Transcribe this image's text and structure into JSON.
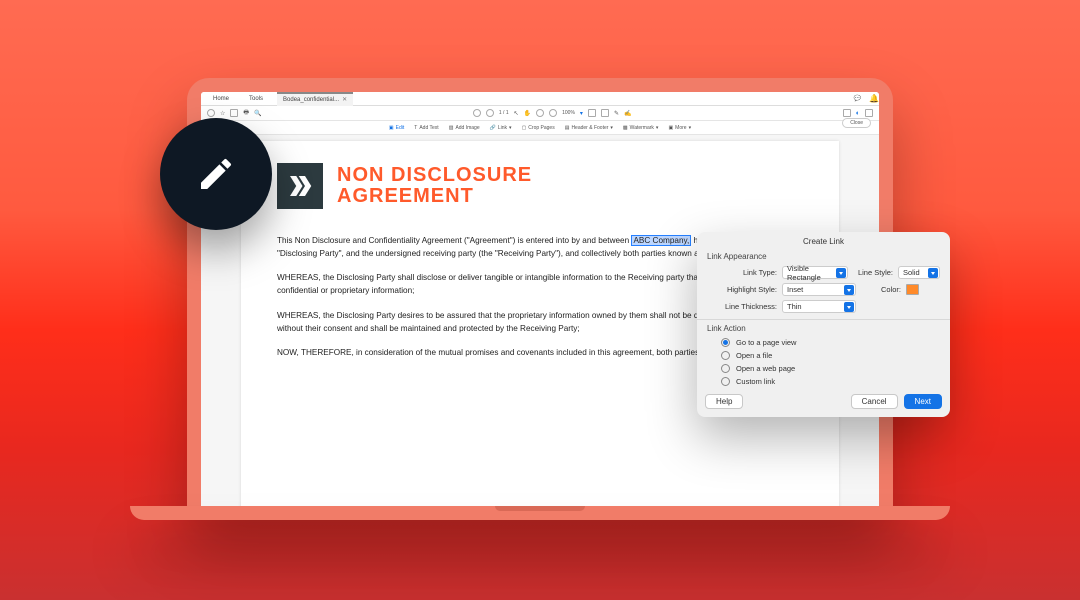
{
  "tabs": {
    "home": "Home",
    "tools": "Tools",
    "file": "Bodea_confidential..."
  },
  "toolbar": {
    "page": "1 / 1",
    "zoom": "100%"
  },
  "edit_tools": {
    "edit": "Edit",
    "add_text": "Add Text",
    "add_image": "Add Image",
    "link": "Link",
    "crop": "Crop Pages",
    "header": "Header & Footer",
    "watermark": "Watermark",
    "more": "More",
    "close": "Close"
  },
  "doc": {
    "title1": "NON DISCLOSURE",
    "title2": "AGREEMENT",
    "p1a": "This Non Disclosure and Confidentiality Agreement (\"Agreement\") is entered into by and between ",
    "p1_hl": "ABC Company,",
    "p1b": " hereinafter known as the \"Disclosing Party\", and the undersigned receiving party (the \"Receiving Party\"), and collectively both parties known as \"Parties\".",
    "p2": "WHEREAS, the Disclosing Party shall disclose or deliver tangible or intangible information to the Receiving party that may be considered confidential or proprietary information;",
    "p3": "WHEREAS, the Disclosing Party desires to be assured that the proprietary information owned by them shall not be disclosed to any third party without their consent and shall be maintained and protected by the Receiving Party;",
    "p4": "NOW, THEREFORE, in consideration of the mutual promises and covenants included in this agreement, both parties agree as follows:"
  },
  "dialog": {
    "title": "Create Link",
    "section1": "Link Appearance",
    "link_type_lbl": "Link Type:",
    "link_type_val": "Visible Rectangle",
    "line_style_lbl": "Line Style:",
    "line_style_val": "Solid",
    "highlight_lbl": "Highlight Style:",
    "highlight_val": "Inset",
    "color_lbl": "Color:",
    "thickness_lbl": "Line Thickness:",
    "thickness_val": "Thin",
    "section2": "Link Action",
    "opt1": "Go to a page view",
    "opt2": "Open a file",
    "opt3": "Open a web page",
    "opt4": "Custom link",
    "help": "Help",
    "cancel": "Cancel",
    "next": "Next"
  }
}
